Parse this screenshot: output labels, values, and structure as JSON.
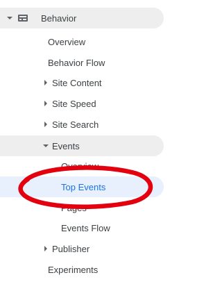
{
  "nav": {
    "behavior": "Behavior",
    "overview": "Overview",
    "behavior_flow": "Behavior Flow",
    "site_content": "Site Content",
    "site_speed": "Site Speed",
    "site_search": "Site Search",
    "events": "Events",
    "events_overview": "Overview",
    "top_events": "Top Events",
    "pages": "Pages",
    "events_flow": "Events Flow",
    "publisher": "Publisher",
    "experiments": "Experiments"
  },
  "colors": {
    "active_text": "#1a73e8",
    "active_bg": "#e8f0fe",
    "expanded_bg": "#eeeeee",
    "annotation": "#e3000f"
  }
}
